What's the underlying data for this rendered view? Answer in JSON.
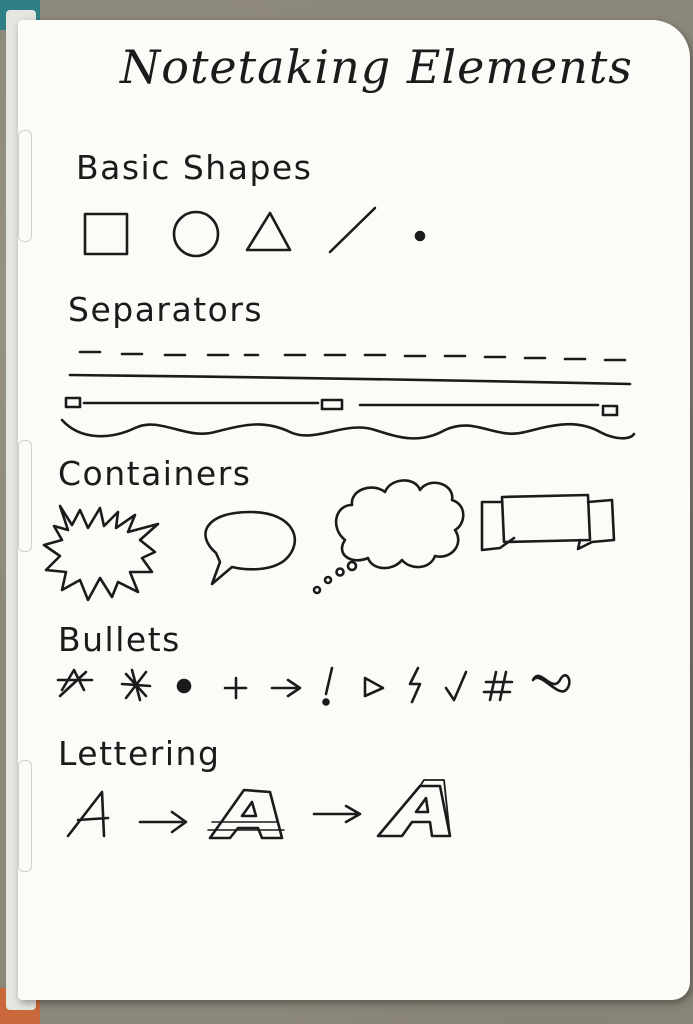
{
  "notebook": {
    "title": "Notetaking Elements",
    "sections": {
      "basic_shapes": {
        "heading": "Basic Shapes",
        "shapes": [
          "square",
          "circle",
          "triangle",
          "line",
          "dot"
        ]
      },
      "separators": {
        "heading": "Separators",
        "styles": [
          "dashed-line",
          "solid-line",
          "bar-with-nodes",
          "wavy-line"
        ]
      },
      "containers": {
        "heading": "Containers",
        "styles": [
          "burst",
          "speech-bubble",
          "thought-cloud",
          "banner"
        ]
      },
      "bullets": {
        "heading": "Bullets",
        "symbols": [
          "✦",
          "✱",
          "●",
          "+",
          "→",
          "!",
          "▷",
          "⚡",
          "✓",
          "#",
          "∞"
        ]
      },
      "lettering": {
        "heading": "Lettering",
        "steps": [
          "A",
          "→",
          "A",
          "→",
          "A"
        ]
      }
    }
  },
  "colors": {
    "ink": "#1b1b1b",
    "paper": "#fbfbf8",
    "background": "#8c877b",
    "teal": "#2f7f86",
    "orange": "#c9683a"
  }
}
